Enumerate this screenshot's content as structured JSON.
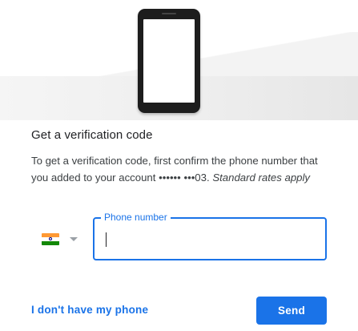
{
  "illustration": {
    "icon": "smartphone-icon"
  },
  "heading": "Get a verification code",
  "description": {
    "text": "To get a verification code, first confirm the phone number that you added to your account •••••• •••03. ",
    "italic": "Standard rates apply"
  },
  "country_selector": {
    "flag_icon": "india-flag-icon",
    "dropdown_icon": "caret-down-icon"
  },
  "phone_field": {
    "label": "Phone number",
    "value": "",
    "placeholder": ""
  },
  "actions": {
    "no_phone_link": "I don't have my phone",
    "send_button": "Send"
  },
  "colors": {
    "accent": "#1a73e8",
    "text_primary": "#202124",
    "text_secondary": "#3c4043"
  }
}
